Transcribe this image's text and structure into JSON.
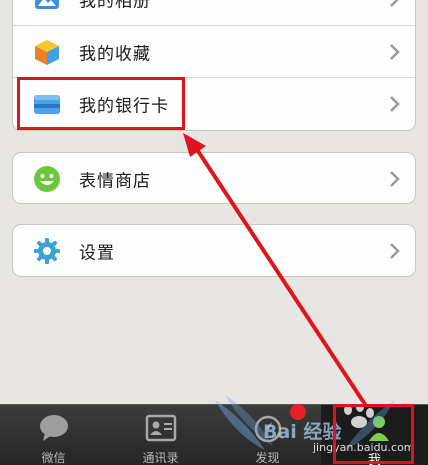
{
  "menu": {
    "album_label": "我的相册",
    "favorites_label": "我的收藏",
    "bank_card_label": "我的银行卡",
    "sticker_shop_label": "表情商店",
    "settings_label": "设置"
  },
  "tabbar": {
    "chats_label": "微信",
    "contacts_label": "通讯录",
    "discover_label": "发现",
    "me_label": "我"
  },
  "watermark": {
    "brand": "Bai 经验",
    "url": "jingyan.baidu.com"
  },
  "colors": {
    "background": "#e8e6e3",
    "highlight_red": "#e0141c",
    "badge_red": "#e8202a",
    "tabbar_bg": "#2e2e2e"
  }
}
